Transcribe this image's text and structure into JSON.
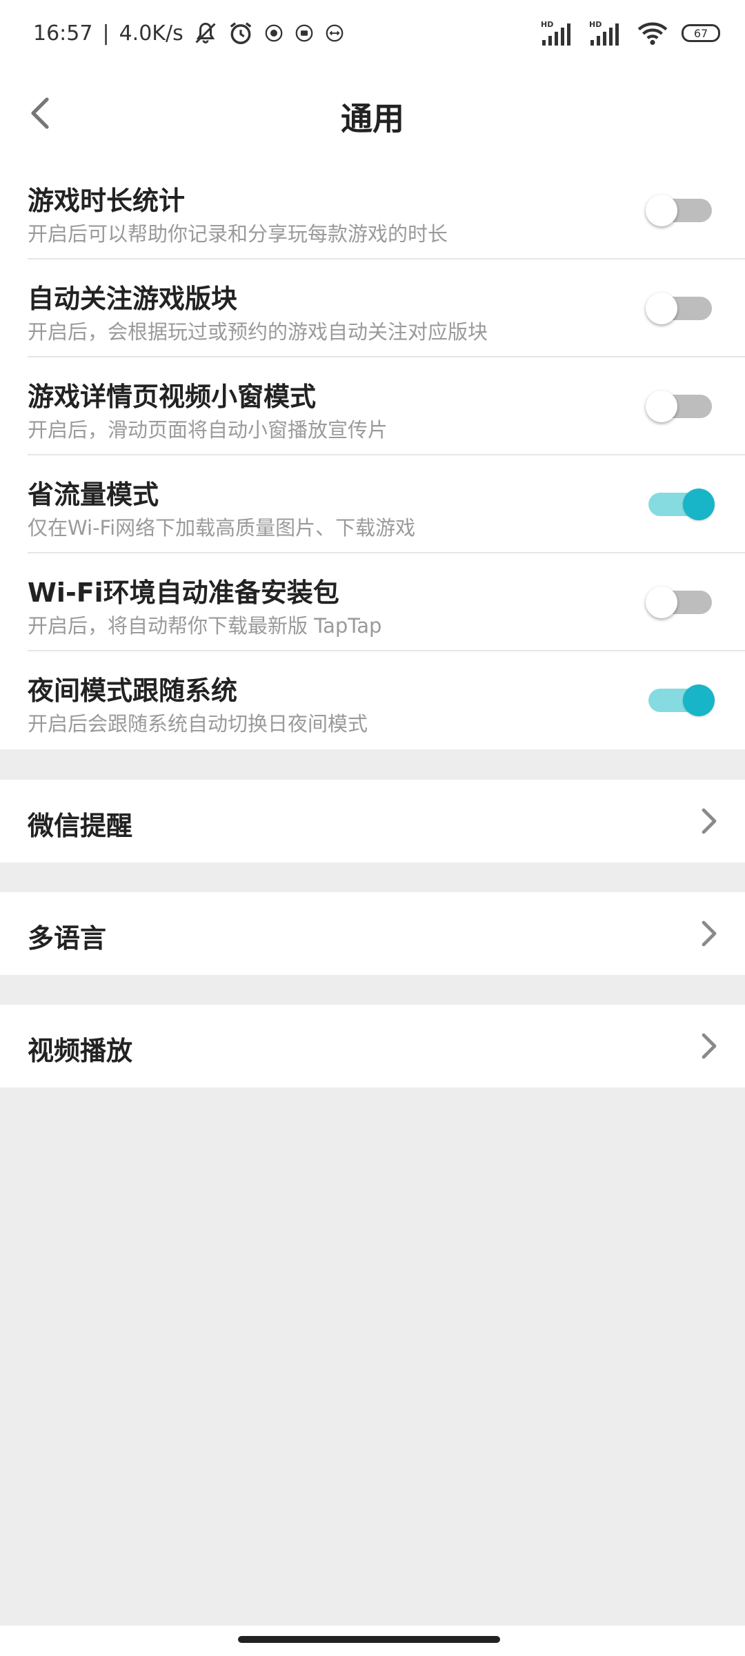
{
  "status_bar": {
    "time": "16:57",
    "separator": "|",
    "net_speed": "4.0K/s",
    "battery": "67",
    "icons": [
      "mute-bell-icon",
      "alarm-icon",
      "app-notification-icon",
      "app-notification-icon",
      "app-notification-icon",
      "signal-hd-icon",
      "signal-hd-icon",
      "wifi-icon",
      "battery-icon"
    ]
  },
  "header": {
    "title": "通用",
    "back_icon": "chevron-left-icon"
  },
  "settings": [
    {
      "title": "游戏时长统计",
      "subtitle": "开启后可以帮助你记录和分享玩每款游戏的时长",
      "enabled": false
    },
    {
      "title": "自动关注游戏版块",
      "subtitle": "开启后，会根据玩过或预约的游戏自动关注对应版块",
      "enabled": false
    },
    {
      "title": "游戏详情页视频小窗模式",
      "subtitle": "开启后，滑动页面将自动小窗播放宣传片",
      "enabled": false
    },
    {
      "title": "省流量模式",
      "subtitle": "仅在Wi-Fi网络下加载高质量图片、下载游戏",
      "enabled": true
    },
    {
      "title": "Wi-Fi环境自动准备安装包",
      "subtitle": "开启后，将自动帮你下载最新版 TapTap",
      "enabled": false
    },
    {
      "title": "夜间模式跟随系统",
      "subtitle": "开启后会跟随系统自动切换日夜间模式",
      "enabled": true
    }
  ],
  "nav_items": [
    {
      "label": "微信提醒"
    },
    {
      "label": "多语言"
    },
    {
      "label": "视频播放"
    }
  ],
  "colors": {
    "toggle_on_track": "#86dbe0",
    "toggle_on_knob": "#17b5c7",
    "toggle_off_track": "#bdbdbd",
    "background": "#ededed"
  }
}
